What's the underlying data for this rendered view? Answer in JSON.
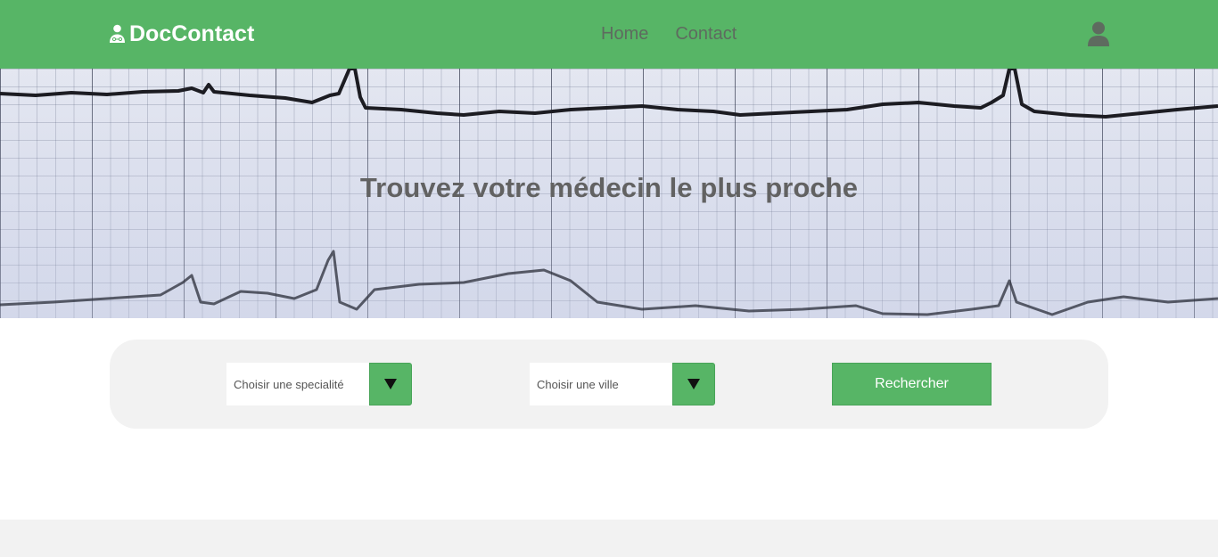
{
  "colors": {
    "brand_green": "#57b566",
    "nav_link_gray": "#5e6b5f",
    "panel_gray": "#f2f2f2",
    "title_gray": "#626262"
  },
  "header": {
    "brand_icon": "doctor-icon",
    "brand": "DocContact",
    "nav": [
      {
        "label": "Home"
      },
      {
        "label": "Contact"
      }
    ],
    "user_icon": "user-icon"
  },
  "hero": {
    "background": "ecg-paper-image",
    "title": "Trouvez votre médecin le plus proche"
  },
  "search": {
    "speciality_select": {
      "value": "Choisir une specialité",
      "arrow_icon": "triangle-down-icon"
    },
    "city_select": {
      "value": "Choisir une ville",
      "arrow_icon": "triangle-down-icon"
    },
    "submit_label": "Rechercher"
  }
}
